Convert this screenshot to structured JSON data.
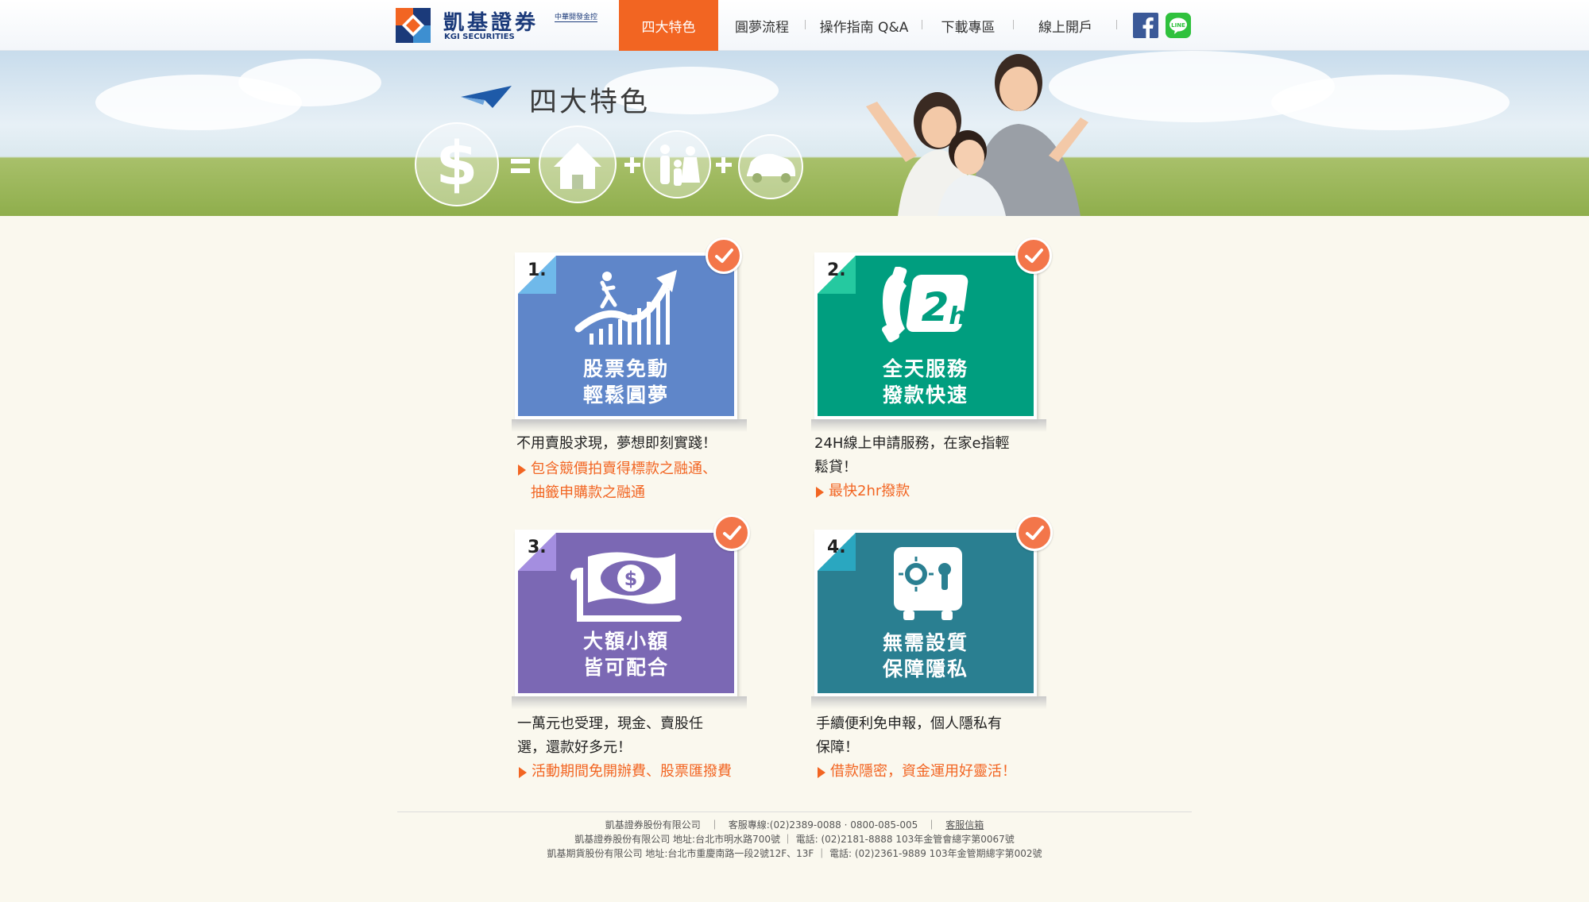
{
  "header": {
    "logo_text": "凱基證券",
    "logo_sub": "KGI SECURITIES",
    "logo_group": "中華開發金控",
    "nav": [
      {
        "label": "四大特色",
        "active": true
      },
      {
        "label": "圓夢流程",
        "active": false
      },
      {
        "label": "操作指南 Q&A",
        "active": false
      },
      {
        "label": "下載專區",
        "active": false
      },
      {
        "label": "線上開戶",
        "active": false
      }
    ],
    "social": [
      "facebook-icon",
      "line-icon"
    ]
  },
  "hero": {
    "title": "四大特色",
    "icons": [
      "dollar-icon",
      "equals-icon",
      "house-icon",
      "plus-icon",
      "family-icon",
      "plus-icon",
      "car-icon"
    ]
  },
  "features": [
    {
      "number": "1.",
      "title_line1": "股票免動",
      "title_line2": "輕鬆圓夢",
      "icon": "growth-chart-icon",
      "color": "#5f86c9",
      "desc_line1": "不用賣股求現，夢想即刻實踐！",
      "desc_line2": "",
      "note_line1": "包含競價拍賣得標款之融通、",
      "note_line2": "抽籤申購款之融通"
    },
    {
      "number": "2.",
      "title_line1": "全天服務",
      "title_line2": "撥款快速",
      "icon": "24h-phone-icon",
      "color": "#009e7f",
      "desc_line1": "24H線上申請服務，在家e指輕",
      "desc_line2": "鬆貸！",
      "note_line1": "最快2hr撥款",
      "note_line2": ""
    },
    {
      "number": "3.",
      "title_line1": "大額小額",
      "title_line2": "皆可配合",
      "icon": "money-icon",
      "color": "#7b68b4",
      "desc_line1": "一萬元也受理，現金、賣股任",
      "desc_line2": "選，還款好多元！",
      "note_line1": "活動期間免開辦費、股票匯撥費",
      "note_line2": ""
    },
    {
      "number": "4.",
      "title_line1": "無需設質",
      "title_line2": "保障隱私",
      "icon": "safe-icon",
      "color": "#2a7f91",
      "desc_line1": "手續便利免申報，個人隱私有",
      "desc_line2": "保障！",
      "note_line1": "借款隱密，資金運用好靈活！",
      "note_line2": ""
    }
  ],
  "footer": {
    "line1_company": "凱基證券股份有限公司",
    "line1_service": "客服專線:(02)2389-0088 · 0800-085-005",
    "line1_link": "客服信箱",
    "line2": "凱基證券股份有限公司 地址:台北市明水路700號  ｜  電話: (02)2181-8888 103年金管會總字第0067號",
    "line3": "凱基期貨股份有限公司 地址:台北市重慶南路一段2號12F、13F  ｜  電話: (02)2361-9889 103年金管期總字第002號"
  },
  "colors": {
    "accent": "#f26522",
    "brand_blue": "#1b3a7a",
    "check": "#f3764a"
  }
}
